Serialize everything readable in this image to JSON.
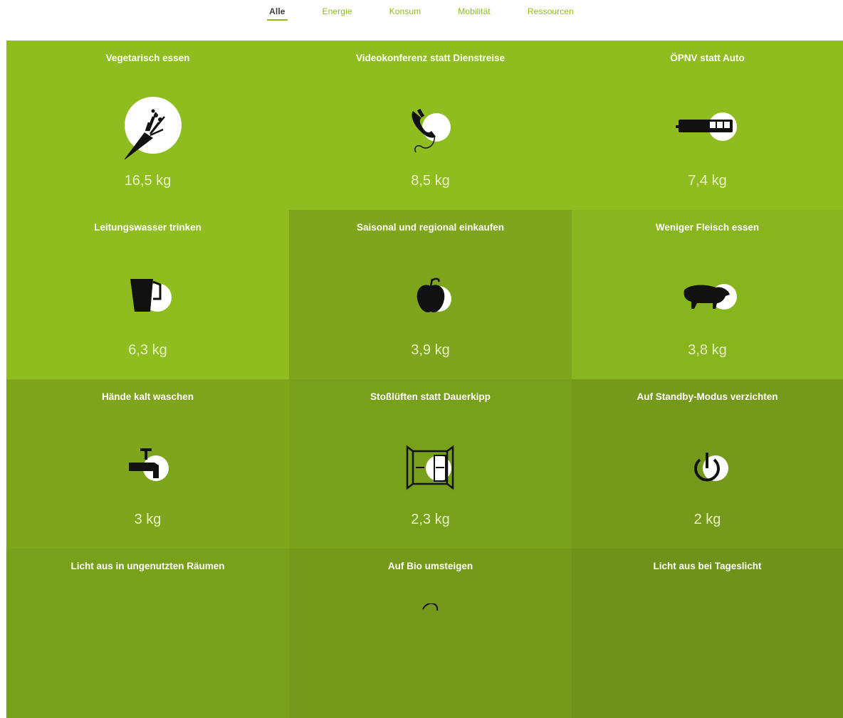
{
  "nav": {
    "tabs": [
      {
        "label": "Alle",
        "active": true
      },
      {
        "label": "Energie",
        "active": false
      },
      {
        "label": "Konsum",
        "active": false
      },
      {
        "label": "Mobilität",
        "active": false
      },
      {
        "label": "Ressourcen",
        "active": false
      }
    ]
  },
  "colors": {
    "accent": "#8fbb1f",
    "tile_shades": [
      "#8fbd1f",
      "#88b41e",
      "#7ea51c",
      "#78a01b",
      "#759a1b",
      "#6f931a"
    ]
  },
  "tiles": [
    {
      "title": "Vegetarisch essen",
      "value": "16,5 kg",
      "icon": "carrot-icon"
    },
    {
      "title": "Videokonferenz statt Dienstreise",
      "value": "8,5 kg",
      "icon": "telephone-icon"
    },
    {
      "title": "ÖPNV statt Auto",
      "value": "7,4 kg",
      "icon": "bus-icon"
    },
    {
      "title": "Leitungswasser trinken",
      "value": "6,3 kg",
      "icon": "water-jug-icon"
    },
    {
      "title": "Saisonal und regional einkaufen",
      "value": "3,9 kg",
      "icon": "apple-icon"
    },
    {
      "title": "Weniger Fleisch essen",
      "value": "3,8 kg",
      "icon": "pig-icon"
    },
    {
      "title": "Hände kalt waschen",
      "value": "3 kg",
      "icon": "faucet-icon"
    },
    {
      "title": "Stoßlüften statt Dauerkipp",
      "value": "2,3 kg",
      "icon": "open-window-icon"
    },
    {
      "title": "Auf Standby-Modus verzichten",
      "value": "2 kg",
      "icon": "power-icon"
    },
    {
      "title": "Licht aus in ungenutzten Räumen",
      "value": "",
      "icon": ""
    },
    {
      "title": "Auf Bio umsteigen",
      "value": "",
      "icon": "leaf-icon"
    },
    {
      "title": "Licht aus bei Tageslicht",
      "value": "",
      "icon": ""
    }
  ]
}
